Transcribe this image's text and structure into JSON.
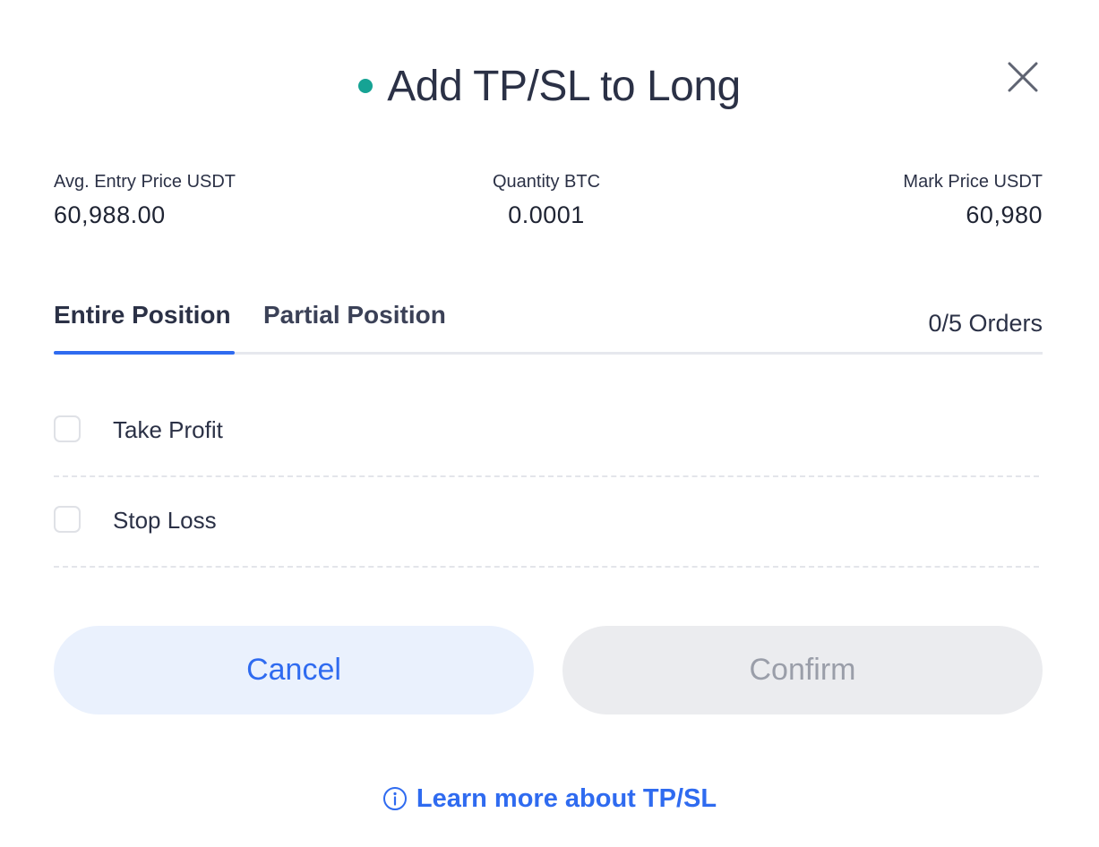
{
  "header": {
    "title": "Add TP/SL to Long",
    "status_color": "#16a394"
  },
  "stats": {
    "entry_price_label": "Avg. Entry Price USDT",
    "entry_price_value": "60,988.00",
    "quantity_label": "Quantity BTC",
    "quantity_value": "0.0001",
    "mark_price_label": "Mark Price USDT",
    "mark_price_value": "60,980"
  },
  "tabs": {
    "entire": "Entire Position",
    "partial": "Partial Position",
    "orders": "0/5 Orders",
    "active": "entire"
  },
  "options": {
    "take_profit": "Take Profit",
    "stop_loss": "Stop Loss"
  },
  "actions": {
    "cancel": "Cancel",
    "confirm": "Confirm"
  },
  "footer": {
    "learn_more": "Learn more about TP/SL"
  },
  "colors": {
    "accent": "#2f6bf0",
    "text": "#2b3146"
  }
}
